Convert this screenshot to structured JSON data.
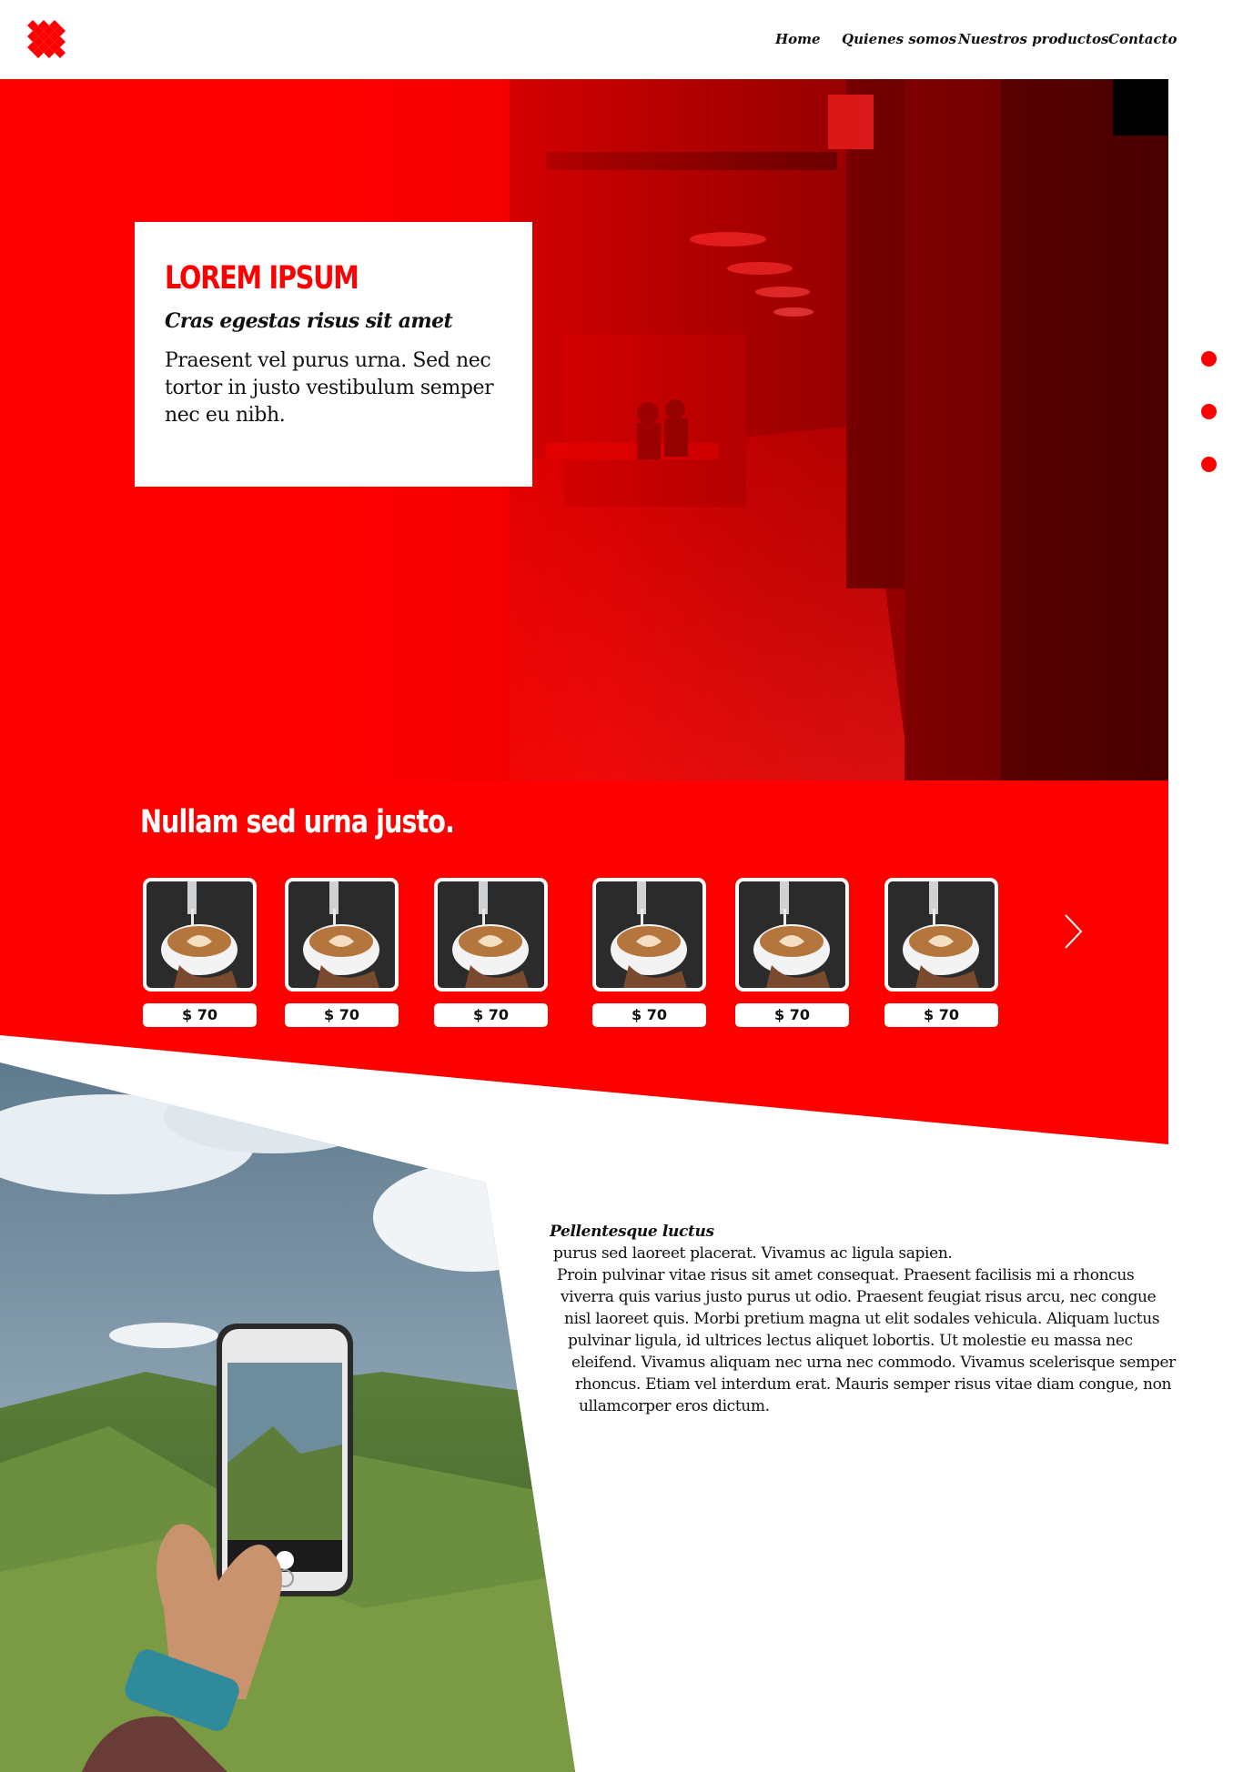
{
  "colors": {
    "accent": "#ff0000",
    "text": "#111111",
    "background": "#ffffff"
  },
  "header": {
    "logo": "red-diamond-grid-logo",
    "nav": [
      "Home",
      "Quienes somos",
      "Nuestros productos",
      "Contacto"
    ]
  },
  "hero": {
    "title": "LOREM IPSUM",
    "subtitle": "Cras egestas risus sit amet",
    "body": "Praesent vel purus urna. Sed nec tortor in justo vestibulum semper nec eu nibh.",
    "background": "red-tinted-office-photo",
    "slider_dots": 3
  },
  "products": {
    "title": "Nullam sed urna justo.",
    "items": [
      {
        "image": "latte-art-cup",
        "price": "$ 70"
      },
      {
        "image": "latte-art-cup",
        "price": "$ 70"
      },
      {
        "image": "latte-art-cup",
        "price": "$ 70"
      },
      {
        "image": "latte-art-cup",
        "price": "$ 70"
      },
      {
        "image": "latte-art-cup",
        "price": "$ 70"
      },
      {
        "image": "latte-art-cup",
        "price": "$ 70"
      }
    ],
    "next_icon": "chevron-right-icon"
  },
  "article": {
    "image": "hand-holding-phone-mountain-photo",
    "title": "Pellentesque luctus",
    "lines": [
      "purus sed laoreet placerat. Vivamus ac ligula sapien.",
      "Proin pulvinar vitae risus sit amet consequat. Praesent facilisis mi a rhoncus",
      "viverra quis varius justo purus ut odio. Praesent feugiat risus arcu, nec congue",
      "nisl laoreet quis. Morbi pretium magna ut elit sodales vehicula. Aliquam luctus",
      "pulvinar ligula, id ultrices lectus aliquet lobortis. Ut molestie eu massa nec",
      "eleifend. Vivamus aliquam nec urna nec commodo. Vivamus scelerisque semper",
      "rhoncus. Etiam vel interdum erat. Mauris semper risus vitae diam congue, non",
      "ullamcorper eros dictum."
    ]
  }
}
